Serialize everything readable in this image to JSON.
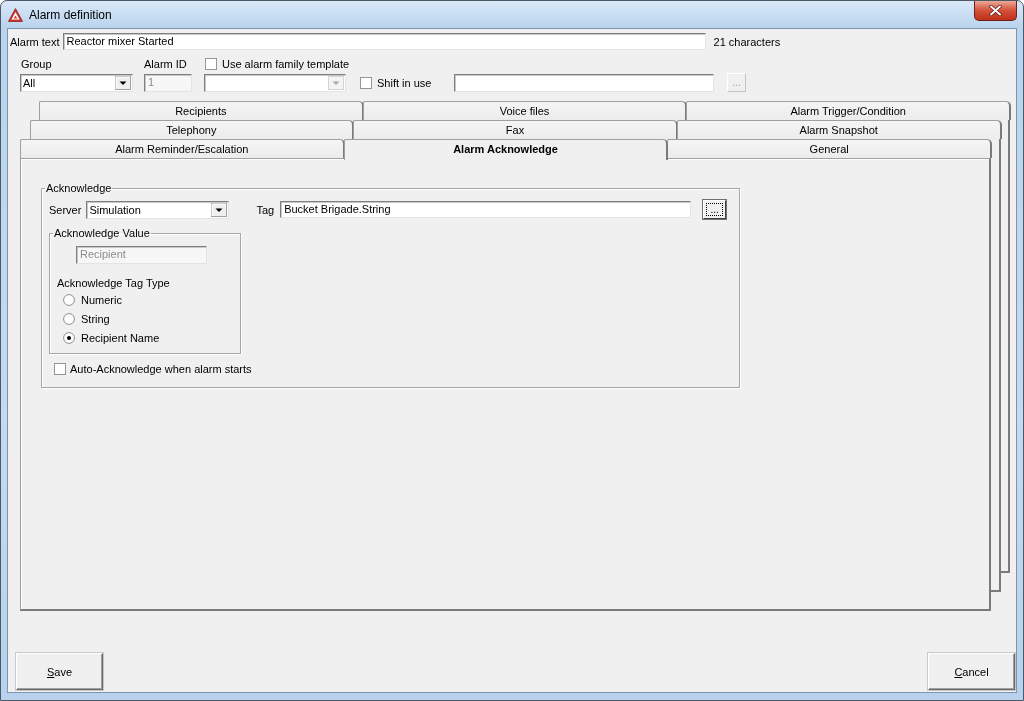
{
  "window": {
    "title": "Alarm definition"
  },
  "alarm_text": {
    "label": "Alarm text",
    "value": "Reactor mixer Started",
    "character_count": "21 characters"
  },
  "group": {
    "label": "Group",
    "value": "All"
  },
  "alarm_id": {
    "label": "Alarm ID",
    "value": "1",
    "disabled": true
  },
  "family_template": {
    "label": "Use alarm family template",
    "checked": false
  },
  "family_dropdown": {
    "disabled": true
  },
  "shift": {
    "label": "Shift in use",
    "checked": false
  },
  "shift_browse_button": {
    "label": "...",
    "disabled": true
  },
  "tab_rows": [
    {
      "tabs": [
        {
          "label": "Recipients",
          "selected": false
        },
        {
          "label": "Voice files",
          "selected": false
        },
        {
          "label": "Alarm Trigger/Condition",
          "selected": false
        }
      ]
    },
    {
      "tabs": [
        {
          "label": "Telephony",
          "selected": false
        },
        {
          "label": "Fax",
          "selected": false
        },
        {
          "label": "Alarm Snapshot",
          "selected": false
        }
      ]
    },
    {
      "tabs": [
        {
          "label": "Alarm Reminder/Escalation",
          "selected": false
        },
        {
          "label": "Alarm Acknowledge",
          "selected": true
        },
        {
          "label": "General",
          "selected": false
        }
      ]
    }
  ],
  "acknowledge": {
    "title": "Acknowledge",
    "server": {
      "label": "Server",
      "value": "Simulation"
    },
    "tag": {
      "label": "Tag",
      "value": "Bucket Brigade.String"
    },
    "tag_browse_button": {
      "label": "...",
      "focused": true
    },
    "value_group": {
      "title": "Acknowledge Value",
      "value": "Recipient",
      "disabled": true,
      "type_label": "Acknowledge Tag Type",
      "tag_types": [
        {
          "label": "Numeric",
          "selected": false
        },
        {
          "label": "String",
          "selected": false
        },
        {
          "label": "Recipient Name",
          "selected": true
        }
      ]
    },
    "auto_acknowledge": {
      "label": "Auto-Acknowledge when alarm starts",
      "checked": false
    }
  },
  "buttons": [
    {
      "label": "Save",
      "access_key_underlined": true
    },
    {
      "label": "Cancel",
      "access_key_underlined": true
    }
  ]
}
